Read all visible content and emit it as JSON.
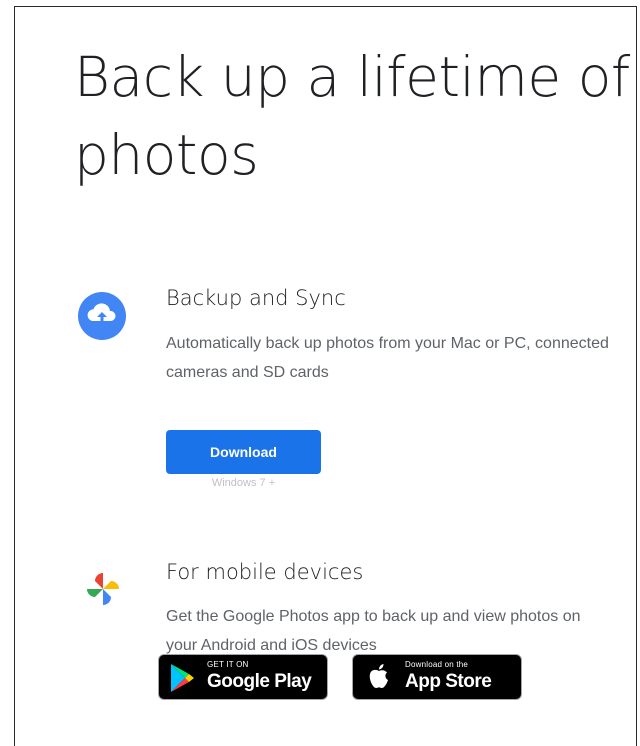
{
  "hero": {
    "title": "Back up a lifetime of photos"
  },
  "backup_section": {
    "icon": "cloud-upload-icon",
    "title": "Backup and Sync",
    "description": "Automatically back up photos from your Mac or PC, connected cameras and SD cards",
    "download_label": "Download",
    "download_note": "Windows 7 +"
  },
  "mobile_section": {
    "icon": "google-photos-pinwheel-icon",
    "title": "For mobile devices",
    "description": "Get the Google Photos app to back up and view photos on your Android and iOS devices",
    "google_play": {
      "small_label": "GET IT ON",
      "big_label": "Google Play",
      "icon": "google-play-icon"
    },
    "app_store": {
      "small_label": "Download on the",
      "big_label": "App Store",
      "icon": "apple-logo-icon"
    }
  },
  "colors": {
    "accent_blue": "#1a73e8",
    "icon_blue": "#4285f4",
    "text_primary": "#202124",
    "text_secondary": "#5f6368",
    "badge_bg": "#000000"
  }
}
